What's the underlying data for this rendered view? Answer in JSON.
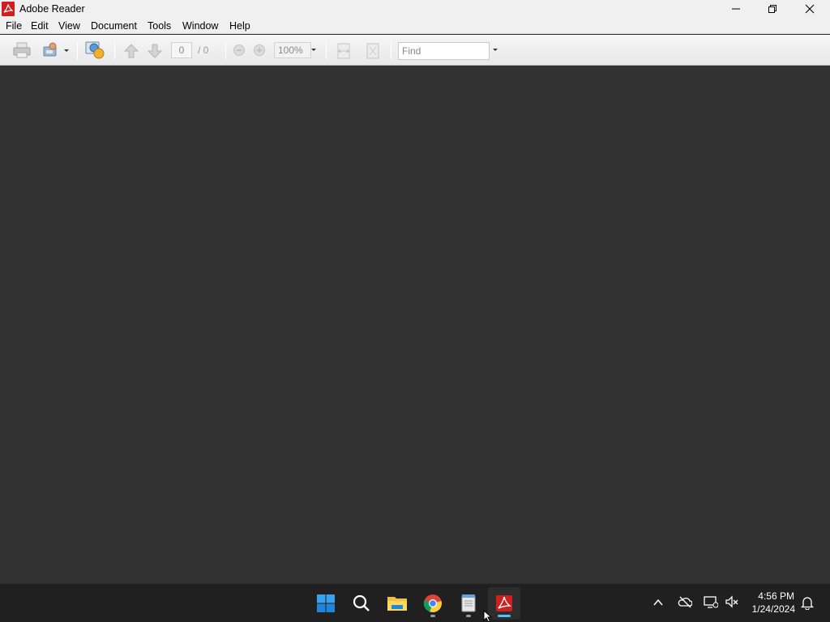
{
  "window": {
    "title": "Adobe Reader",
    "icons": [
      "adobe-reader-icon",
      "minimize-icon",
      "maximize-icon",
      "close-icon"
    ]
  },
  "menu": [
    "File",
    "Edit",
    "View",
    "Document",
    "Tools",
    "Window",
    "Help"
  ],
  "toolbar": {
    "icons": [
      "print-icon",
      "share-icon",
      "collaborate-icon",
      "previous-page-icon",
      "next-page-icon",
      "zoom-out-icon",
      "zoom-in-icon",
      "fit-width-icon",
      "fit-page-icon"
    ],
    "page_current": "0",
    "page_total": "/ 0",
    "zoom": "100%",
    "find_placeholder": "Find"
  },
  "taskbar": {
    "apps": [
      "start-icon",
      "search-icon",
      "file-explorer-icon",
      "chrome-icon",
      "notepad-icon",
      "adobe-reader-icon"
    ],
    "tray_icons": [
      "chevron-up-icon",
      "onedrive-icon",
      "network-icon",
      "volume-muted-icon",
      "notification-icon"
    ],
    "time": "4:56 PM",
    "date": "1/24/2024"
  },
  "colors": {
    "doc_background": "#323232",
    "taskbar": "#202020",
    "adobe_red": "#d01f1f",
    "active_indicator": "#4cc2ff"
  }
}
